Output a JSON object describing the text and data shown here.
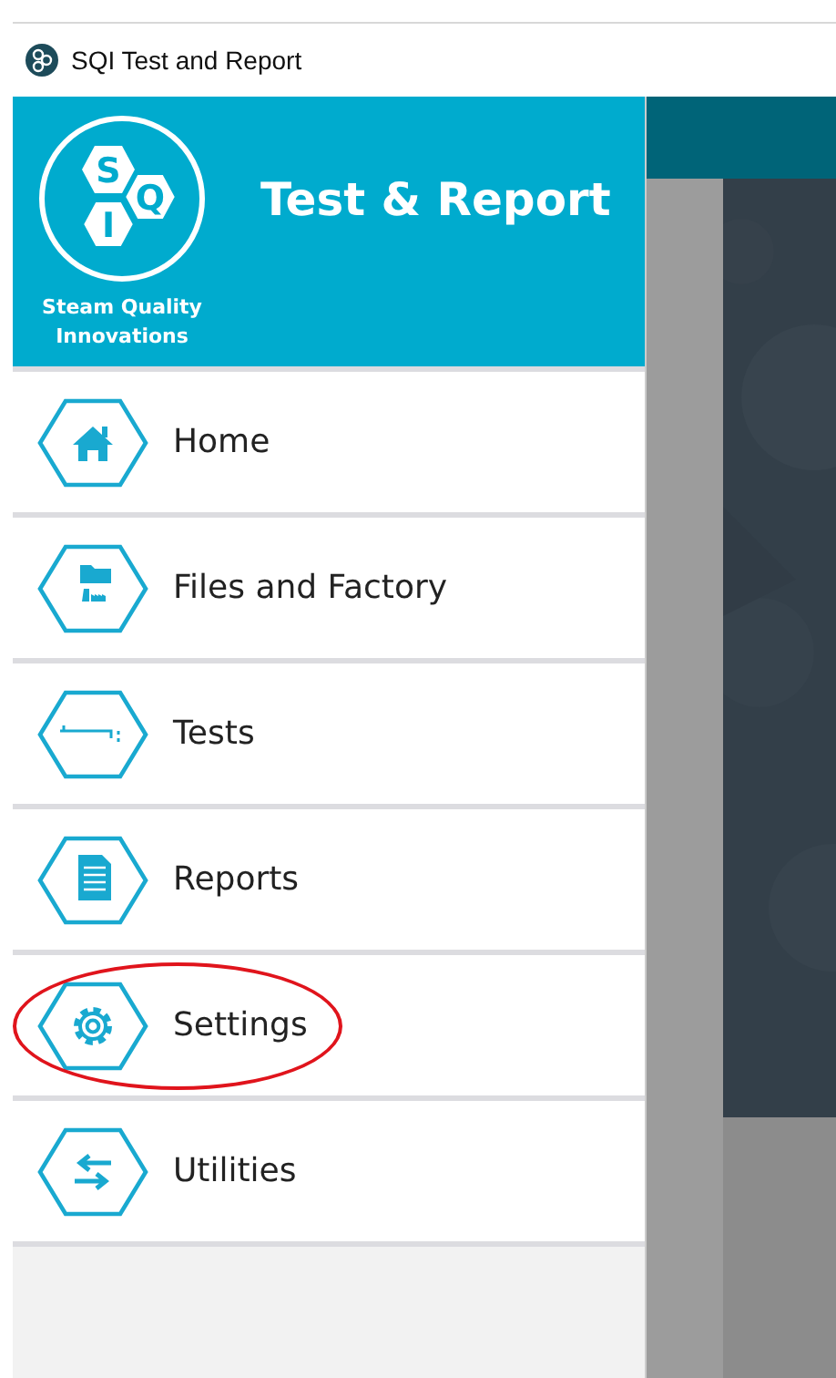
{
  "window": {
    "title": "SQI Test and Report"
  },
  "header": {
    "logo_letters": [
      "S",
      "Q",
      "I"
    ],
    "company": "Steam Quality Innovations",
    "app_title": "Test & Report"
  },
  "menu": {
    "items": [
      {
        "label": "Home",
        "kind": "home",
        "circled": false
      },
      {
        "label": "Files and Factory",
        "kind": "files",
        "circled": false
      },
      {
        "label": "Tests",
        "kind": "tests",
        "circled": false
      },
      {
        "label": "Reports",
        "kind": "reports",
        "circled": false
      },
      {
        "label": "Settings",
        "kind": "settings",
        "circled": true
      },
      {
        "label": "Utilities",
        "kind": "utilities",
        "circled": false
      }
    ]
  }
}
